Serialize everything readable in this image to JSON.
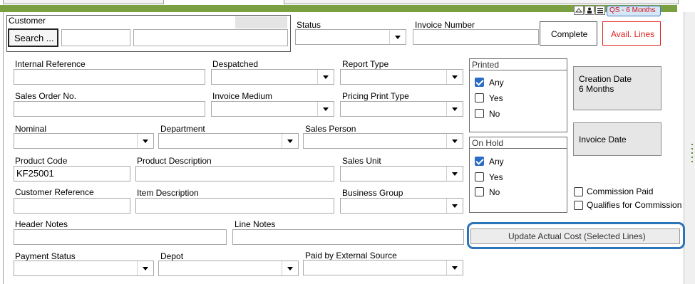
{
  "toolbar": {
    "qs_badge": "QS - 6 Months"
  },
  "customer": {
    "label": "Customer",
    "search_button": "Search ...",
    "code_value": "",
    "name_value": ""
  },
  "status": {
    "label": "Status",
    "value": ""
  },
  "invoice_number": {
    "label": "Invoice Number",
    "value": ""
  },
  "buttons": {
    "complete": "Complete",
    "avail_lines": "Avail. Lines",
    "creation_date": "Creation Date\n6 Months",
    "invoice_date": "Invoice Date",
    "update_actual_cost": "Update Actual Cost (Selected Lines)"
  },
  "fields": {
    "internal_reference": {
      "label": "Internal Reference",
      "value": ""
    },
    "despatched": {
      "label": "Despatched",
      "value": ""
    },
    "report_type": {
      "label": "Report Type",
      "value": ""
    },
    "sales_order_no": {
      "label": "Sales Order No.",
      "value": ""
    },
    "invoice_medium": {
      "label": "Invoice Medium",
      "value": ""
    },
    "pricing_print_type": {
      "label": "Pricing Print Type",
      "value": ""
    },
    "nominal": {
      "label": "Nominal",
      "value": ""
    },
    "department": {
      "label": "Department",
      "value": ""
    },
    "sales_person": {
      "label": "Sales Person",
      "value": ""
    },
    "product_code": {
      "label": "Product Code",
      "value": "KF25001"
    },
    "product_description": {
      "label": "Product Description",
      "value": ""
    },
    "sales_unit": {
      "label": "Sales Unit",
      "value": ""
    },
    "customer_reference": {
      "label": "Customer Reference",
      "value": ""
    },
    "item_description": {
      "label": "Item Description",
      "value": ""
    },
    "business_group": {
      "label": "Business Group",
      "value": ""
    },
    "header_notes": {
      "label": "Header Notes",
      "value": ""
    },
    "line_notes": {
      "label": "Line Notes",
      "value": ""
    },
    "payment_status": {
      "label": "Payment Status",
      "value": ""
    },
    "depot": {
      "label": "Depot",
      "value": ""
    },
    "paid_by_external_source": {
      "label": "Paid by External Source",
      "value": ""
    }
  },
  "printed": {
    "title": "Printed",
    "options": [
      {
        "label": "Any",
        "checked": true
      },
      {
        "label": "Yes",
        "checked": false
      },
      {
        "label": "No",
        "checked": false
      }
    ]
  },
  "on_hold": {
    "title": "On Hold",
    "options": [
      {
        "label": "Any",
        "checked": true
      },
      {
        "label": "Yes",
        "checked": false
      },
      {
        "label": "No",
        "checked": false
      }
    ]
  },
  "commission": {
    "paid": {
      "label": "Commission Paid",
      "checked": false
    },
    "qualifies": {
      "label": "Qualifies for Commission",
      "checked": false
    }
  },
  "colors": {
    "header_green": "#7aa042",
    "accent_blue": "#2b6cc4",
    "highlight_ring": "#2a74b9",
    "alert_red": "#e02020"
  }
}
